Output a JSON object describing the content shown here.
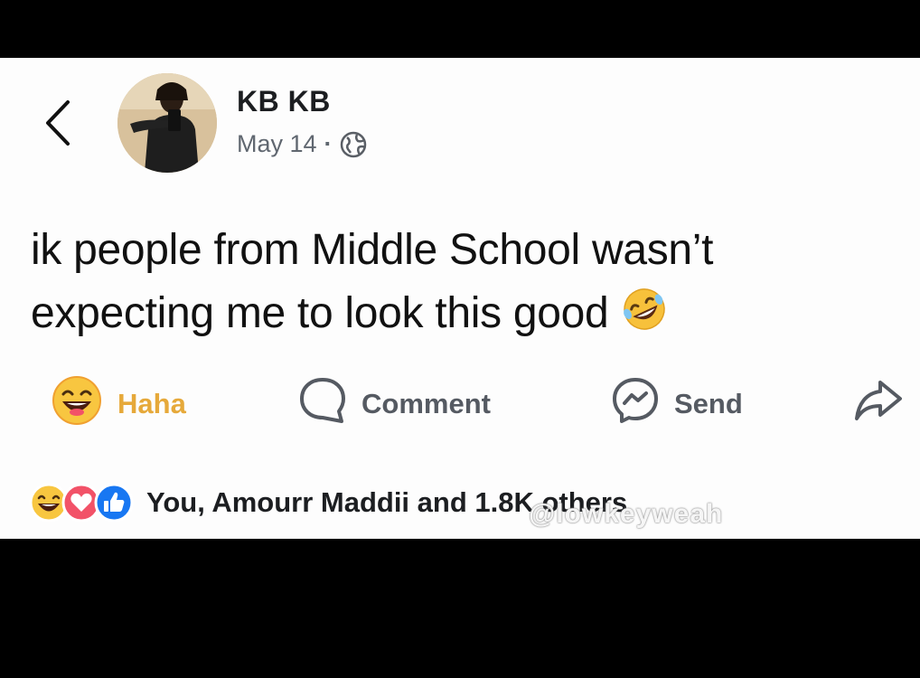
{
  "post": {
    "author": "KB KB",
    "date": "May 14",
    "separator": "·",
    "privacy_icon": "globe-icon",
    "text_line1": "ik people from Middle School wasn’t",
    "text_line2": "expecting me to look this good",
    "text_emoji": "rolling-on-floor-laughing-emoji"
  },
  "actions": {
    "haha_label": "Haha",
    "comment_label": "Comment",
    "send_label": "Send",
    "share_icon": "share-arrow-icon"
  },
  "reactions": {
    "icons": [
      "haha-reaction-icon",
      "love-reaction-icon",
      "like-reaction-icon"
    ],
    "summary": "You, Amourr Maddii and 1.8K others"
  },
  "watermark": "@lowkeyweah",
  "colors": {
    "haha": "#e6a93a",
    "love": "#f25268",
    "like": "#1877f2",
    "text": "#111111",
    "muted": "#606770"
  }
}
